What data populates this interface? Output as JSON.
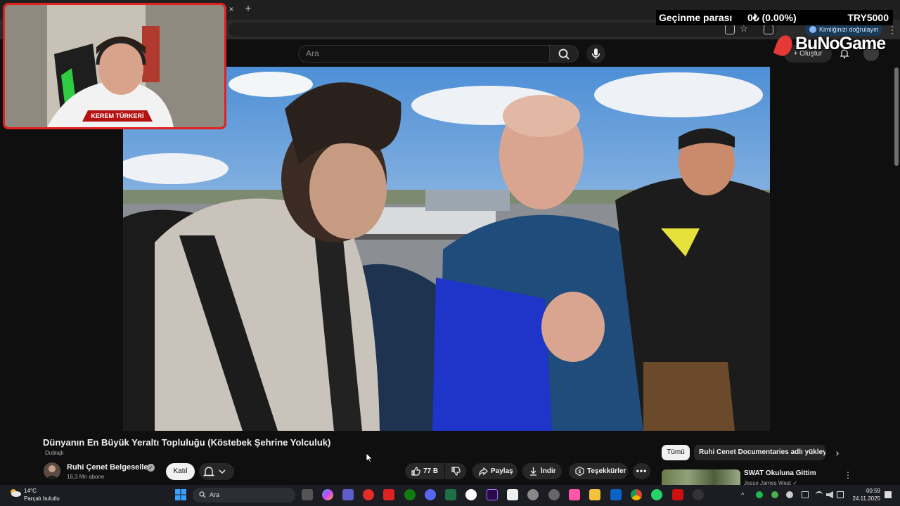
{
  "browser": {
    "tab_close": "×",
    "tab_new": "+",
    "verify_label": "Kimliğinizi doğrulayın",
    "menu": "⋮"
  },
  "youtube_header": {
    "search_placeholder": "Ara",
    "create_label": "+ Oluştur"
  },
  "overlay": {
    "stat_label": "Geçinme parası",
    "stat_value": "0₺ (0.00%)",
    "stat_goal": "TRY5000",
    "brand": "BuNoGame",
    "streamer_name": "KEREM TÜRKERİ",
    "stars": "★★★★★"
  },
  "video": {
    "title": "Dünyanın En Büyük Yeraltı Topluluğu (Köstebek Şehrine Yolculuk)",
    "dubbed": "Dublajlı",
    "channel_name": "Ruhi Çenet Belgeselleri",
    "verified": "✓",
    "subscribers": "16,3 Mn abone",
    "join_label": "Katıl",
    "like_count": "77 B",
    "share_label": "Paylaş",
    "download_label": "İndir",
    "thanks_label": "Teşekkürler",
    "more": "•••"
  },
  "recommendations": {
    "chip_all": "Tümü",
    "chip_uploads": "Ruhi Cenet Documentaries adlı yükleyiciden",
    "next": "›",
    "first_title": "SWAT Okuluna Gittim",
    "first_channel": "Jesse James West ✓",
    "more": "⋮"
  },
  "taskbar": {
    "weather_temp": "14°C",
    "weather_desc": "Parçalı bulutlu",
    "search_label": "Ara",
    "time": "00:59",
    "date": "24.11.2025"
  }
}
